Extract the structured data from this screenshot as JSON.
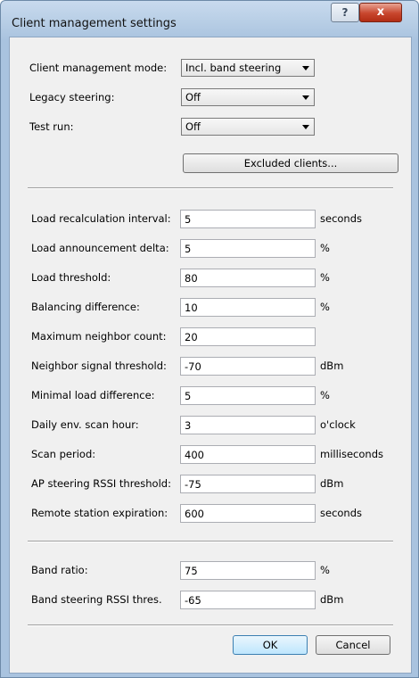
{
  "window": {
    "title": "Client management settings",
    "help_label": "?",
    "close_label": "x"
  },
  "top": {
    "mode": {
      "label": "Client management mode:",
      "value": "Incl. band steering"
    },
    "legacy": {
      "label": "Legacy steering:",
      "value": "Off"
    },
    "testrun": {
      "label": "Test run:",
      "value": "Off"
    },
    "excluded_label": "Excluded clients..."
  },
  "fields": [
    {
      "label": "Load recalculation interval:",
      "value": "5",
      "unit": "seconds"
    },
    {
      "label": "Load announcement delta:",
      "value": "5",
      "unit": "%"
    },
    {
      "label": "Load threshold:",
      "value": "80",
      "unit": "%"
    },
    {
      "label": "Balancing difference:",
      "value": "10",
      "unit": "%"
    },
    {
      "label": "Maximum neighbor count:",
      "value": "20",
      "unit": ""
    },
    {
      "label": "Neighbor signal threshold:",
      "value": "-70",
      "unit": "dBm"
    },
    {
      "label": "Minimal load difference:",
      "value": "5",
      "unit": "%"
    },
    {
      "label": "Daily env. scan hour:",
      "value": "3",
      "unit": "o'clock"
    },
    {
      "label": "Scan period:",
      "value": "400",
      "unit": "milliseconds"
    },
    {
      "label": "AP steering RSSI threshold:",
      "value": "-75",
      "unit": "dBm"
    },
    {
      "label": "Remote station expiration:",
      "value": "600",
      "unit": "seconds"
    }
  ],
  "band": [
    {
      "label": "Band ratio:",
      "value": "75",
      "unit": "%"
    },
    {
      "label": "Band steering RSSI thres.",
      "value": "-65",
      "unit": "dBm"
    }
  ],
  "buttons": {
    "ok": "OK",
    "cancel": "Cancel"
  }
}
